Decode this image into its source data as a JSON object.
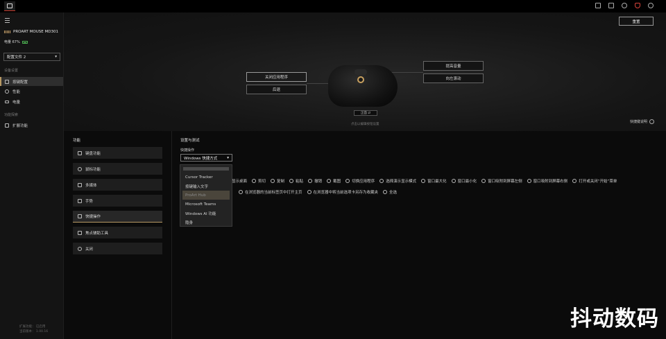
{
  "titlebar": {
    "icons": [
      "keyboard-icon",
      "image-icon",
      "sync-icon",
      "bell-icon",
      "settings-icon"
    ]
  },
  "sidebar": {
    "device_name": "PROART MOUSE MD301",
    "battery": "电量 67%",
    "profile": "配置文件 2",
    "section_device": "设备设置",
    "items": [
      {
        "label": "按键配置",
        "icon": "mouse-icon",
        "active": true
      },
      {
        "label": "性能",
        "icon": "gauge-icon",
        "active": false
      },
      {
        "label": "电量",
        "icon": "battery-icon",
        "active": false
      }
    ],
    "section_features": "功能探索",
    "feature_items": [
      {
        "label": "扩展功能",
        "icon": "extension-icon"
      }
    ],
    "footer": [
      "扩展功能： 已启用",
      "当前版本： 1.00.16"
    ]
  },
  "preview": {
    "reset_label": "重置",
    "left_callouts": [
      "关闭应用程序",
      "后退"
    ],
    "right_callouts": [
      "提高音量",
      "向左滚动"
    ],
    "view_toggle": "正面",
    "hint": "点击以编辑按钮设置",
    "shortcut_help": "快捷键说明"
  },
  "functions": {
    "title": "功能",
    "items": [
      {
        "label": "键盘功能",
        "icon": "keyboard-icon",
        "active": false
      },
      {
        "label": "鼠标功能",
        "icon": "mouse-icon",
        "active": false
      },
      {
        "label": "多媒体",
        "icon": "media-icon",
        "active": false
      },
      {
        "label": "手势",
        "icon": "gesture-icon",
        "active": false
      },
      {
        "label": "快捷操作",
        "icon": "shortcut-icon",
        "active": true
      },
      {
        "label": "焦点辅助工具",
        "icon": "focus-icon",
        "active": false
      },
      {
        "label": "关闭",
        "icon": "disable-icon",
        "active": false
      }
    ]
  },
  "settings": {
    "title": "设置与测试",
    "shortcut_label": "快捷操作",
    "shortcut_value": "Windows 快捷方式",
    "radio_row1": [
      "显示桌面",
      "剪切",
      "复制",
      "粘贴",
      "撤销",
      "截图",
      "切换应用程序",
      "选择演示显示模式",
      "窗口最大化",
      "窗口最小化",
      "窗口吸附到屏幕左侧",
      "窗口吸附到屏幕右侧",
      "打开或关闭“开始”菜单"
    ],
    "radio_row2": [
      "在浏览器的当前标签页中打开主页",
      "在浏览器中将当前选项卡另存为收藏夹",
      "全选"
    ],
    "dropdown_options": [
      "Cursor Tracker",
      "按键输入文字",
      "ProArt Hub",
      "Microsoft Teams",
      "Windows AI 功能",
      "隐身"
    ],
    "dropdown_hover_index": 2
  },
  "watermark": "抖动数码"
}
